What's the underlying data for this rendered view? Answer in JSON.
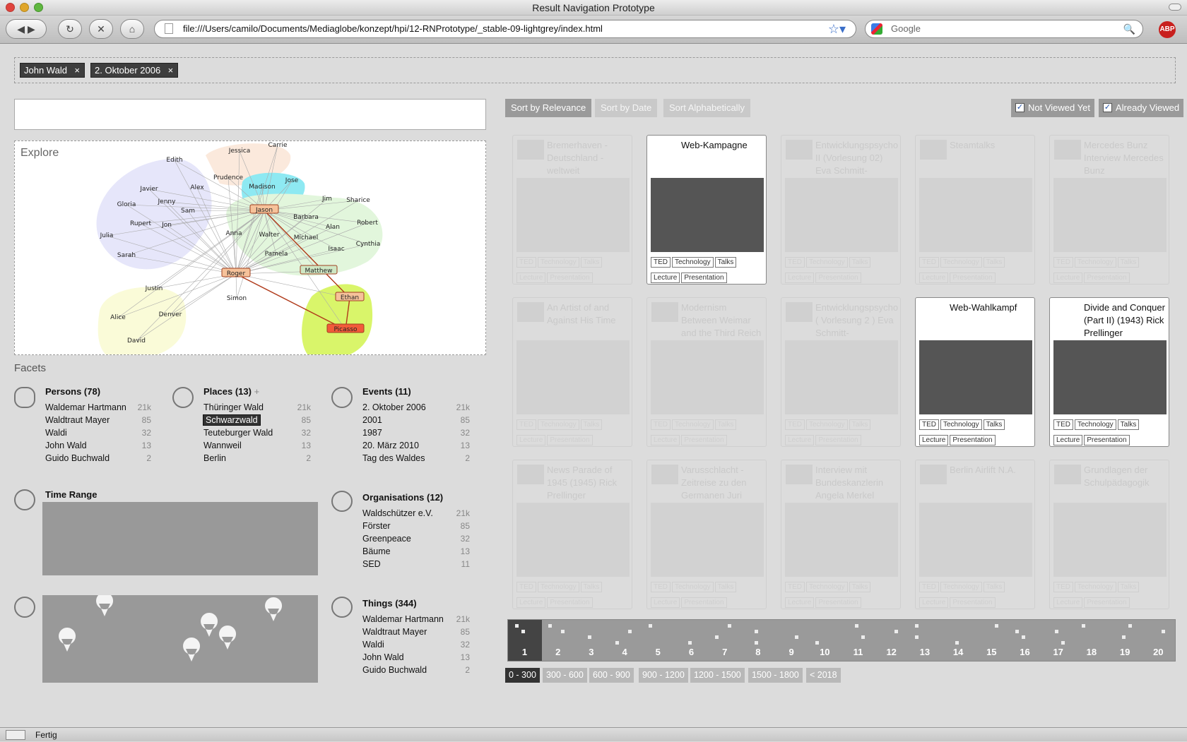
{
  "window": {
    "title": "Result Navigation Prototype"
  },
  "toolbar": {
    "url": "file:///Users/camilo/Documents/Mediaglobe/konzept/hpi/12-RNPrototype/_stable-09-lightgrey/index.html",
    "search_placeholder": "Google",
    "abp": "ABP"
  },
  "filters": [
    {
      "label": "John Wald",
      "remove": "×"
    },
    {
      "label": "2. Oktober 2006",
      "remove": "×"
    }
  ],
  "explore": {
    "label": "Explore",
    "nodes": [
      "Jessica",
      "Carrie",
      "Edith",
      "Prudence",
      "Jose",
      "Madison",
      "Javier",
      "Alex",
      "Jason",
      "Jim",
      "Sharice",
      "Gloria",
      "Jenny",
      "Sam",
      "Barbara",
      "Rupert",
      "Jon",
      "Alan",
      "Robert",
      "Julia",
      "Anna",
      "Walter",
      "Michael",
      "Isaac",
      "Cynthia",
      "Sarah",
      "Pamela",
      "Matthew",
      "Roger",
      "Justin",
      "Ethan",
      "Simon",
      "Alice",
      "Denver",
      "Picasso",
      "David"
    ]
  },
  "facets": {
    "title": "Facets",
    "persons": {
      "title": "Persons (78)",
      "items": [
        {
          "name": "Waldemar Hartmann",
          "count": "21k"
        },
        {
          "name": "Waldtraut Mayer",
          "count": "85"
        },
        {
          "name": "Waldi",
          "count": "32"
        },
        {
          "name": "John Wald",
          "count": "13"
        },
        {
          "name": "Guido Buchwald",
          "count": "2"
        }
      ]
    },
    "places": {
      "title": "Places (13)",
      "plus": "+",
      "items": [
        {
          "name": "Thüringer Wald",
          "count": "21k"
        },
        {
          "name": "Schwarzwald",
          "count": "85"
        },
        {
          "name": "Teuteburger Wald",
          "count": "32"
        },
        {
          "name": "Wannweil",
          "count": "13"
        },
        {
          "name": "Berlin",
          "count": "2"
        }
      ]
    },
    "events": {
      "title": "Events (11)",
      "items": [
        {
          "name": "2. Oktober 2006",
          "count": "21k"
        },
        {
          "name": "2001",
          "count": "85"
        },
        {
          "name": "1987",
          "count": "32"
        },
        {
          "name": "20. März 2010",
          "count": "13"
        },
        {
          "name": "Tag des Waldes",
          "count": "2"
        }
      ]
    },
    "time_range": {
      "title": "Time Range"
    },
    "organisations": {
      "title": "Organisations (12)",
      "items": [
        {
          "name": "Waldschützer e.V.",
          "count": "21k"
        },
        {
          "name": "Förster",
          "count": "85"
        },
        {
          "name": "Greenpeace",
          "count": "32"
        },
        {
          "name": "Bäume",
          "count": "13"
        },
        {
          "name": "SED",
          "count": "11"
        }
      ]
    },
    "things": {
      "title": "Things (344)",
      "items": [
        {
          "name": "Waldemar Hartmann",
          "count": "21k"
        },
        {
          "name": "Waldtraut Mayer",
          "count": "85"
        },
        {
          "name": "Waldi",
          "count": "32"
        },
        {
          "name": "John Wald",
          "count": "13"
        },
        {
          "name": "Guido Buchwald",
          "count": "2"
        }
      ]
    }
  },
  "sort": {
    "relevance": "Sort by Relevance",
    "date": "Sort by Date",
    "alpha": "Sort Alphabetically"
  },
  "view_filters": {
    "not_viewed": "Not Viewed Yet",
    "viewed": "Already Viewed",
    "check": "✓"
  },
  "results": [
    {
      "title": "Bremerhaven - Deutschland - weltweit",
      "active": false,
      "tags": [
        "TED",
        "Technology",
        "Talks",
        "Lecture",
        "Presentation"
      ]
    },
    {
      "title": "Web-Kampagne",
      "active": true,
      "tags": [
        "TED",
        "Technology",
        "Talks",
        "Lecture",
        "Presentation"
      ]
    },
    {
      "title": "Entwicklungspsycho II (Vorlesung 02) Eva Schmitt-",
      "active": false,
      "tags": [
        "TED",
        "Technology",
        "Talks",
        "Lecture",
        "Presentation"
      ]
    },
    {
      "title": "Steamtalks",
      "active": false,
      "tags": [
        "TED",
        "Technology",
        "Talks",
        "Lecture",
        "Presentation"
      ]
    },
    {
      "title": "Mercedes Bunz Interview Mercedes Bunz",
      "active": false,
      "tags": [
        "TED",
        "Technology",
        "Talks",
        "Lecture",
        "Presentation"
      ]
    },
    {
      "title": "An Artist of and Against His Time",
      "active": false,
      "tags": [
        "TED",
        "Technology",
        "Talks",
        "Lecture",
        "Presentation"
      ]
    },
    {
      "title": "Modernism Between Weimar and the Third Reich",
      "active": false,
      "tags": [
        "TED",
        "Technology",
        "Talks",
        "Lecture",
        "Presentation"
      ]
    },
    {
      "title": "Entwicklungspsycho ( Vorlesung 2 ) Eva Schmitt-",
      "active": false,
      "tags": [
        "TED",
        "Technology",
        "Talks",
        "Lecture",
        "Presentation"
      ]
    },
    {
      "title": "Web-Wahlkampf",
      "active": true,
      "tags": [
        "TED",
        "Technology",
        "Talks",
        "Lecture",
        "Presentation"
      ]
    },
    {
      "title": "Divide and Conquer (Part II) (1943) Rick Prellinger",
      "active": true,
      "tags": [
        "TED",
        "Technology",
        "Talks",
        "Lecture",
        "Presentation"
      ]
    },
    {
      "title": "News Parade of 1945 (1945) Rick Prellinger",
      "active": false,
      "tags": [
        "TED",
        "Technology",
        "Talks",
        "Lecture",
        "Presentation"
      ]
    },
    {
      "title": "Varusschlacht - Zeitreise zu den Germanen Juri",
      "active": false,
      "tags": [
        "TED",
        "Technology",
        "Talks",
        "Lecture",
        "Presentation"
      ]
    },
    {
      "title": "Interview mit Bundeskanzlerin Angela Merkel",
      "active": false,
      "tags": [
        "TED",
        "Technology",
        "Talks",
        "Lecture",
        "Presentation"
      ]
    },
    {
      "title": "Berlin Airlift N.A.",
      "active": false,
      "tags": [
        "TED",
        "Technology",
        "Talks",
        "Lecture",
        "Presentation"
      ]
    },
    {
      "title": "Grundlagen der Schulpädagogik",
      "active": false,
      "tags": [
        "TED",
        "Technology",
        "Talks",
        "Lecture",
        "Presentation"
      ]
    }
  ],
  "pages": [
    "1",
    "2",
    "3",
    "4",
    "5",
    "6",
    "7",
    "8",
    "9",
    "10",
    "11",
    "12",
    "13",
    "14",
    "15",
    "16",
    "17",
    "18",
    "19",
    "20"
  ],
  "current_page": "1",
  "ranges": [
    "0 - 300",
    "300 - 600",
    "600 - 900",
    "900 - 1200",
    "1200 - 1500",
    "1500 - 1800",
    "< 2018"
  ],
  "status": {
    "text": "Fertig"
  },
  "colors": {
    "accent_dark": "#333333",
    "panel_gray": "#9a9a9a"
  }
}
